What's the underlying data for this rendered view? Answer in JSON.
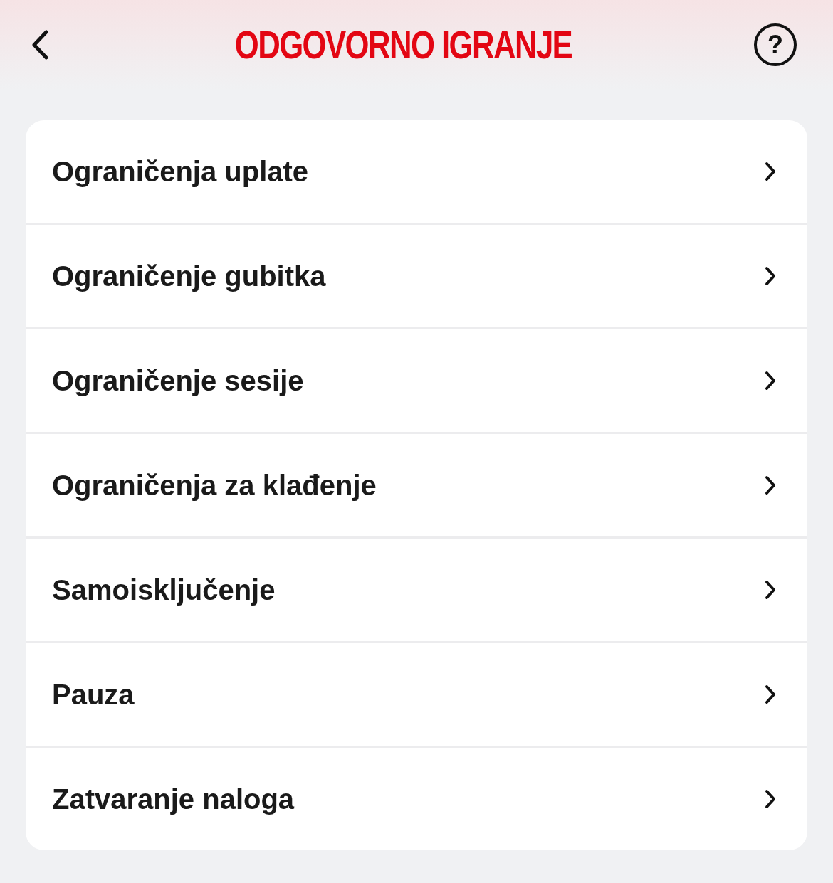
{
  "header": {
    "title": "ODGOVORNO IGRANJE",
    "help": "?"
  },
  "menu": [
    {
      "label": "Ograničenja uplate"
    },
    {
      "label": "Ograničenje gubitka"
    },
    {
      "label": "Ograničenje sesije"
    },
    {
      "label": "Ograničenja za klađenje"
    },
    {
      "label": "Samoisključenje"
    },
    {
      "label": "Pauza"
    },
    {
      "label": "Zatvaranje naloga"
    }
  ]
}
